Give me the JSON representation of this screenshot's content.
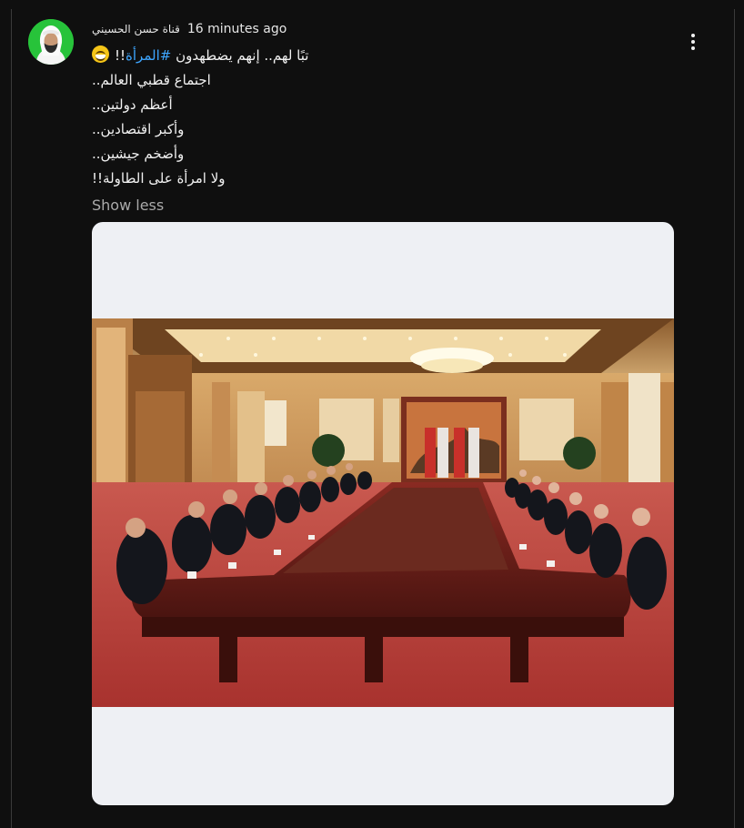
{
  "post": {
    "author": "قناة حسن الحسيني",
    "time": "16 minutes ago",
    "lines": {
      "l1_prefix": "تبًا لهم.. إنهم يضطهدون ",
      "l1_hashtag": "#المرأة",
      "l1_suffix": "!!",
      "l2": "اجتماع قطبي العالم..",
      "l3": "أعظم دولتين..",
      "l4": "وأكبر اقتصادين..",
      "l5": "وأضخم جيشين..",
      "l6": "ولا امرأة على الطاولة!!"
    },
    "emoji_icon": "grinning-face-emoji",
    "show_less": "Show less"
  },
  "menu_icon": "more-vertical-icon",
  "colors": {
    "background": "#0f0f0f",
    "link": "#3ea6ff",
    "muted": "#aaaaaa",
    "avatar_bg": "#27c33a"
  }
}
